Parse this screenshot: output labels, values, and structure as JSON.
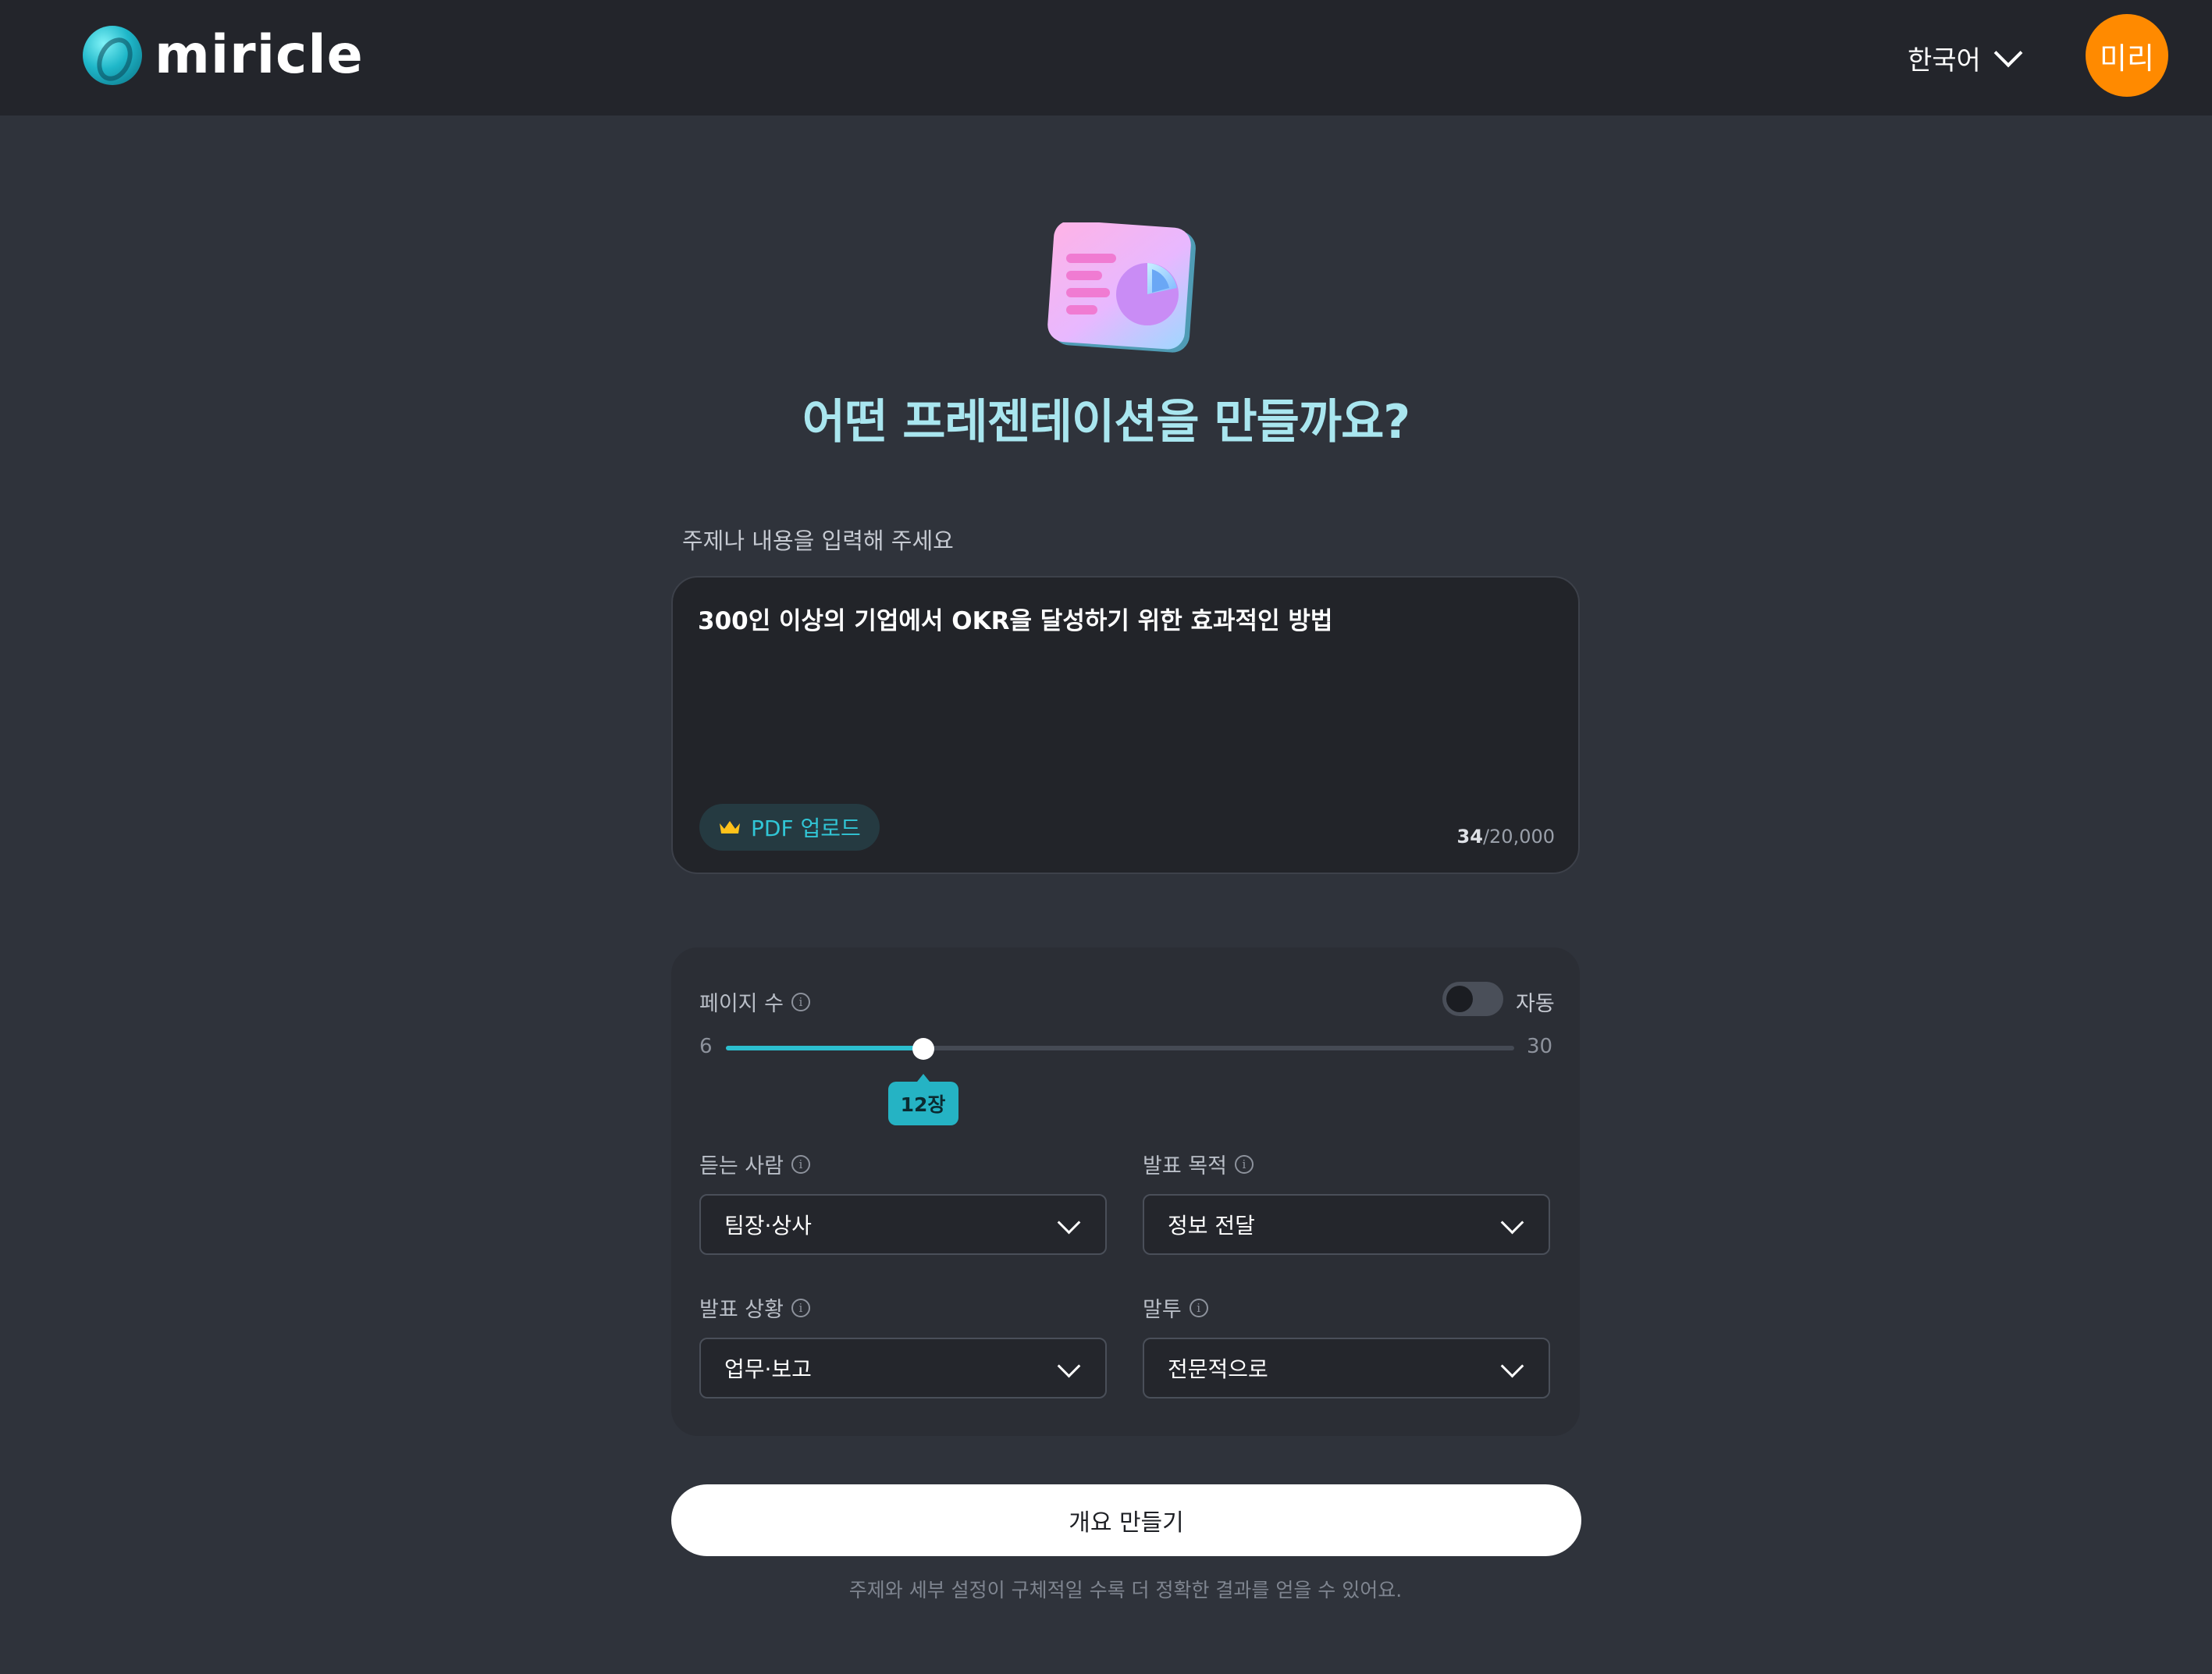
{
  "header": {
    "logo_text": "miricle",
    "language": "한국어",
    "avatar_text": "미리"
  },
  "hero": {
    "title": "어떤 프레젠테이션을 만들까요?"
  },
  "prompt": {
    "label": "주제나 내용을 입력해 주세요",
    "value": "300인 이상의 기업에서 OKR을 달성하기 위한 효과적인 방법",
    "pdf_upload_label": "PDF 업로드",
    "char_count": "34",
    "char_limit": "/20,000"
  },
  "settings": {
    "page_count": {
      "label": "페이지 수",
      "auto_label": "자동",
      "auto_enabled": false,
      "min": "6",
      "max": "30",
      "value": 12,
      "value_label": "12장"
    },
    "audience": {
      "label": "듣는 사람",
      "value": "팀장·상사"
    },
    "purpose": {
      "label": "발표 목적",
      "value": "정보 전달"
    },
    "situation": {
      "label": "발표 상황",
      "value": "업무·보고"
    },
    "tone": {
      "label": "말투",
      "value": "전문적으로"
    }
  },
  "cta": {
    "label": "개요 만들기",
    "hint": "주제와 세부 설정이 구체적일 수록 더 정확한 결과를 얻을 수 있어요."
  },
  "colors": {
    "accent": "#2cbfcf",
    "avatar": "#ff8a00",
    "title": "#a9e6ef",
    "background": "#2f333b"
  }
}
